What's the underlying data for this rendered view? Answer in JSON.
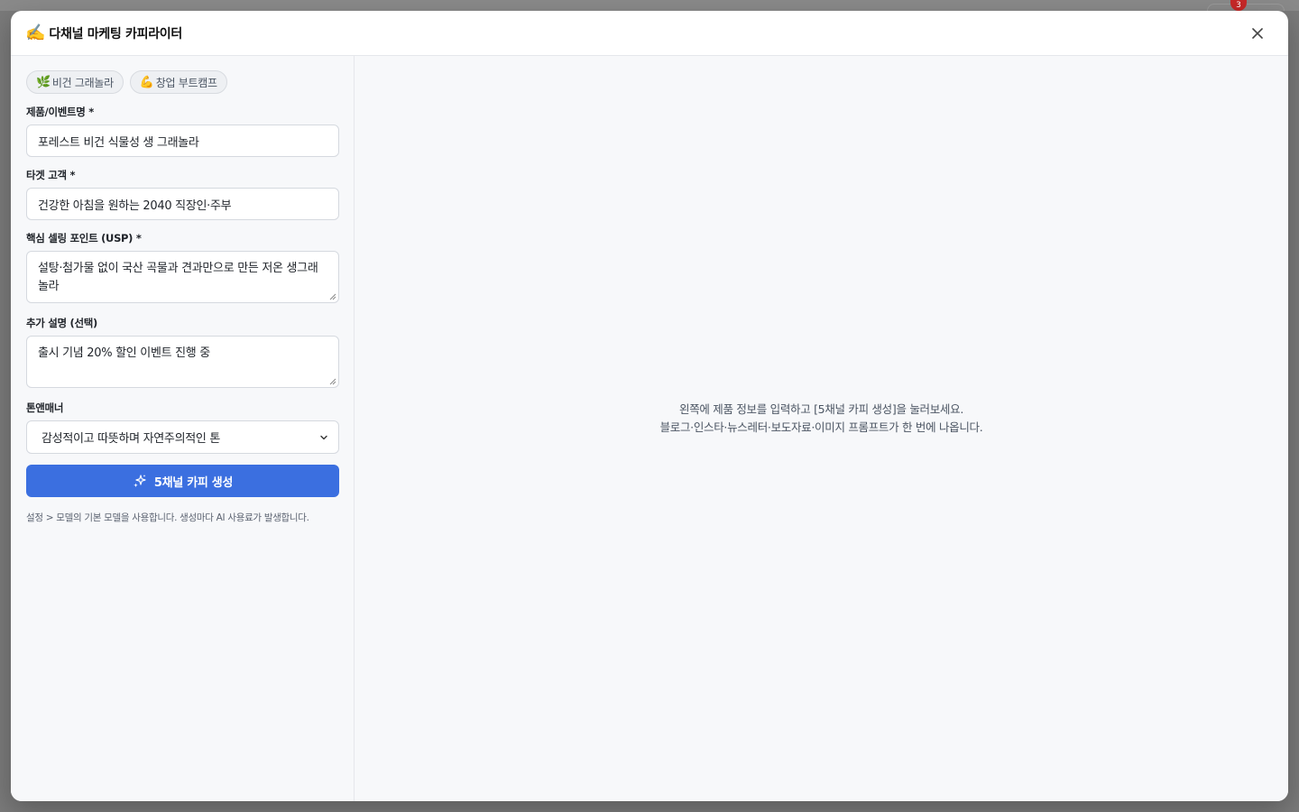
{
  "background": {
    "badge_count": "3"
  },
  "modal": {
    "title_emoji": "✍️",
    "title": "다채널 마케팅 카피라이터"
  },
  "presets": [
    {
      "emoji": "🌿",
      "label": "비건 그래놀라"
    },
    {
      "emoji": "💪",
      "label": "창업 부트캠프"
    }
  ],
  "form": {
    "product": {
      "label": "제품/이벤트명 *",
      "value": "포레스트 비건 식물성 생 그래놀라"
    },
    "target": {
      "label": "타겟 고객 *",
      "value": "건강한 아침을 원하는 2040 직장인·주부"
    },
    "usp": {
      "label": "핵심 셀링 포인트 (USP) *",
      "value": "설탕·첨가물 없이 국산 곡물과 견과만으로 만든 저온 생그래놀라"
    },
    "extra": {
      "label": "추가 설명 (선택)",
      "value": "출시 기념 20% 할인 이벤트 진행 중"
    },
    "tone": {
      "label": "톤앤매너",
      "selected": "감성적이고 따뜻하며 자연주의적인 톤"
    },
    "generate_label": "5채널 카피 생성",
    "note": "설정 > 모델의 기본 모델을 사용합니다. 생성마다 AI 사용료가 발생합니다."
  },
  "empty_state": {
    "line1": "왼쪽에 제품 정보를 입력하고 [5채널 카피 생성]을 눌러보세요.",
    "line2": "블로그·인스타·뉴스레터·보도자료·이미지 프롬프트가 한 번에 나옵니다."
  },
  "colors": {
    "accent": "#3b6fe0",
    "panel_bg": "#f7f8fa",
    "badge": "#c62828"
  }
}
